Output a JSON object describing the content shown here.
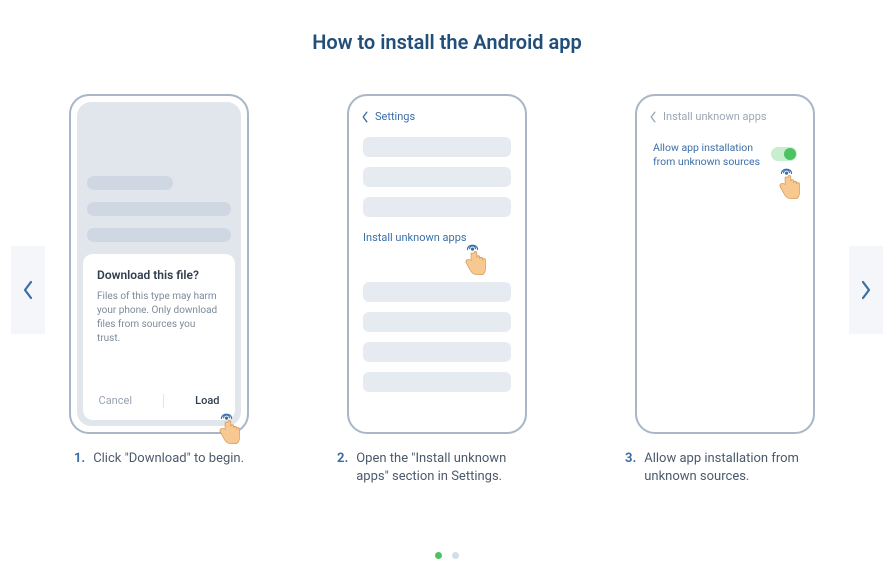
{
  "title": "How to install the Android app",
  "steps": [
    {
      "num": "1.",
      "caption": "Click \"Download\" to begin.",
      "dialog_title": "Download this file?",
      "dialog_body": "Files of this type may harm your phone. Only download files from sources you trust.",
      "cancel": "Cancel",
      "load": "Load"
    },
    {
      "num": "2.",
      "caption": "Open the \"Install unknown apps\" section in Settings.",
      "header": "Settings",
      "link": "Install unknown apps"
    },
    {
      "num": "3.",
      "caption": "Allow app installation from unknown sources.",
      "header": "Install unknown apps",
      "toggle_label": "Allow app installation from unknown sources"
    }
  ],
  "colors": {
    "accent": "#3a6ea5",
    "green": "#4cc261"
  },
  "pagination": {
    "total": 2,
    "active": 0
  }
}
